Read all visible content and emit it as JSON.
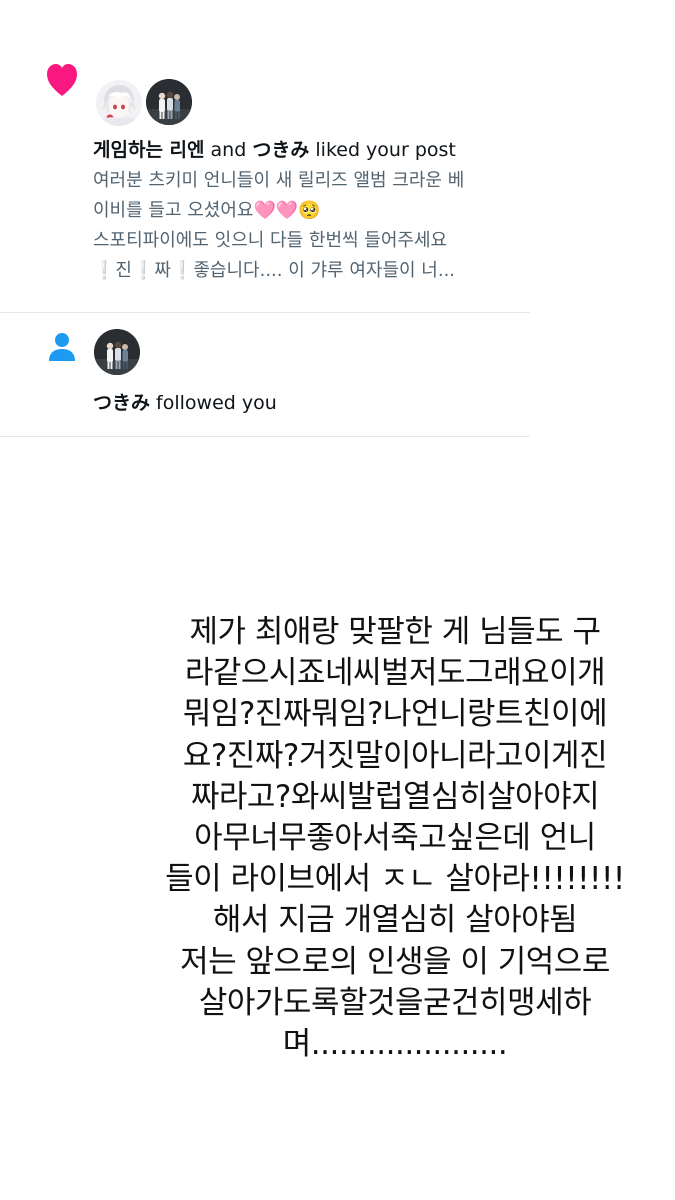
{
  "notifications": [
    {
      "type": "like",
      "type_icon": "heart-icon",
      "icon_color": "#f91880",
      "avatars": [
        "avatar-white-hair-character",
        "avatar-group-photo"
      ],
      "user1": "게임하는 리엔",
      "joiner": " and ",
      "user2": "つきみ",
      "action": " liked your post",
      "preview_lines": [
        "여러분 츠키미 언니들이 새 릴리즈 앨범 크라운 베",
        "이비를 들고 오셨어요🩷🩷🥺",
        " 스포티파이에도 잇으니 다들 한번씩 들어주세요",
        "❕진❕짜❕좋습니다.... 이 갸루 여자들이 너..."
      ]
    },
    {
      "type": "follow",
      "type_icon": "person-icon",
      "icon_color": "#1d9bf0",
      "avatars": [
        "avatar-group-photo"
      ],
      "user": "つきみ",
      "action": " followed you"
    }
  ],
  "story_text": [
    "제가 최애랑 맞팔한 게 님들도 구",
    "라같으시죠네씨벌저도그래요이개",
    "뭐임?진짜뭐임?나언니랑트친이에",
    "요?진짜?거짓말이아니라고이게진",
    "짜라고?와씨발럽열심히살아야지",
    "아무너무좋아서죽고싶은데 언니",
    "들이 라이브에서 ㅈㄴ 살아라!!!!!!!!",
    "해서 지금 개열심히 살아야됨",
    "저는 앞으로의 인생을 이 기억으로",
    "살아가도록할것을굳건히맹세하",
    "며....................."
  ]
}
